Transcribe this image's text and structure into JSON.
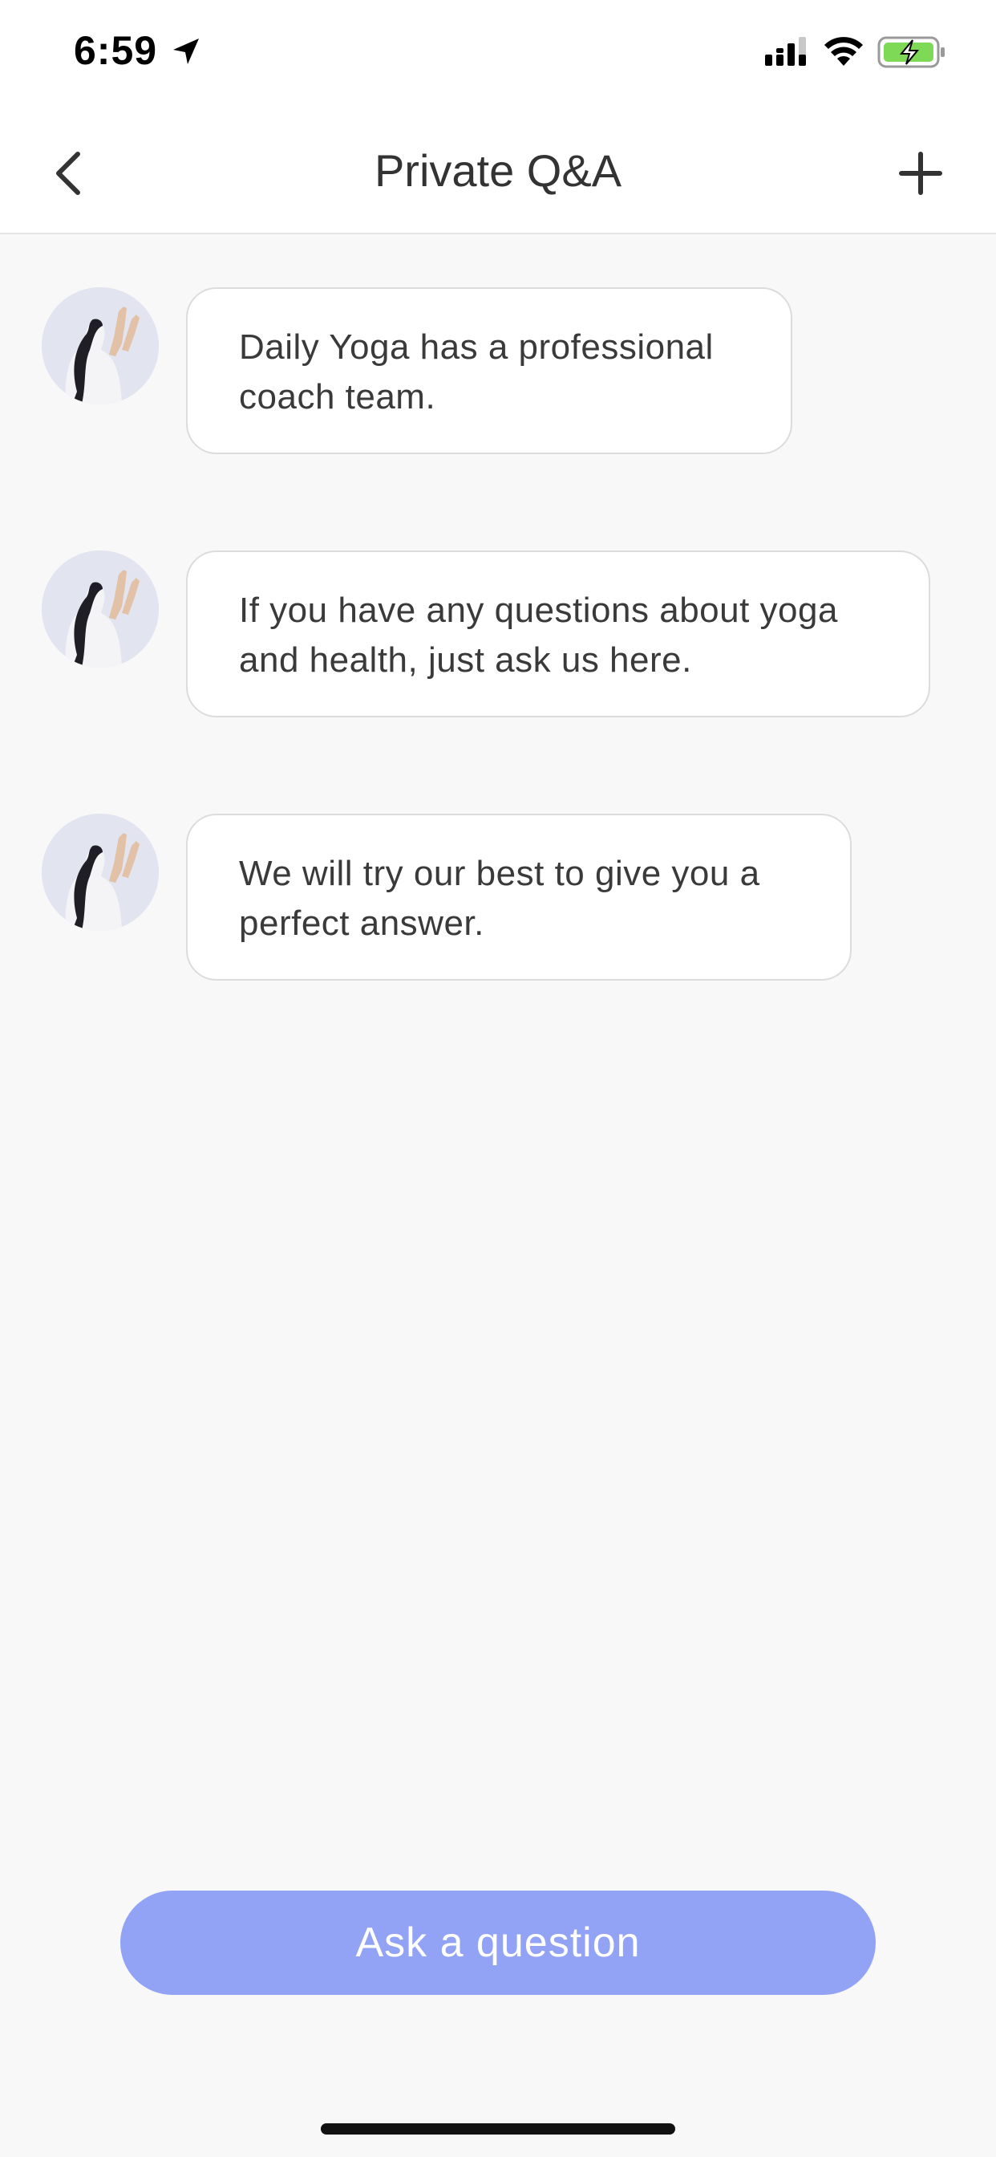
{
  "status_bar": {
    "time": "6:59",
    "icons": [
      "location-arrow-icon",
      "cellular-signal-icon",
      "wifi-icon",
      "battery-charging-icon"
    ]
  },
  "nav": {
    "title": "Private Q&A",
    "back_icon": "chevron-left-icon",
    "add_icon": "plus-icon"
  },
  "messages": [
    {
      "avatar": "coach-avatar",
      "text_line1": "Daily Yoga has a professional",
      "text_line2": "coach team."
    },
    {
      "avatar": "coach-avatar",
      "text_line1": "If you have any questions about yoga",
      "text_line2": "and health, just ask us here."
    },
    {
      "avatar": "coach-avatar",
      "text_line1": "We will try our best to give you a",
      "text_line2": "perfect answer."
    }
  ],
  "ask_button": {
    "label": "Ask a question"
  },
  "colors": {
    "background": "#f8f8f8",
    "accent": "#92a3f6",
    "battery_green": "#7ed957"
  }
}
